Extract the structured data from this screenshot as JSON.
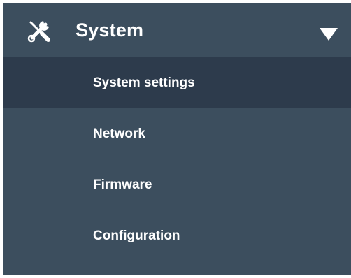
{
  "colors": {
    "panel_bg": "#3c4e5e",
    "active_item_bg": "#2d3b4c",
    "text": "#ffffff"
  },
  "menu": {
    "title": "System",
    "icon": "tools-icon",
    "expanded": true,
    "items": [
      {
        "label": "System settings",
        "active": true
      },
      {
        "label": "Network",
        "active": false
      },
      {
        "label": "Firmware",
        "active": false
      },
      {
        "label": "Configuration",
        "active": false
      }
    ]
  }
}
